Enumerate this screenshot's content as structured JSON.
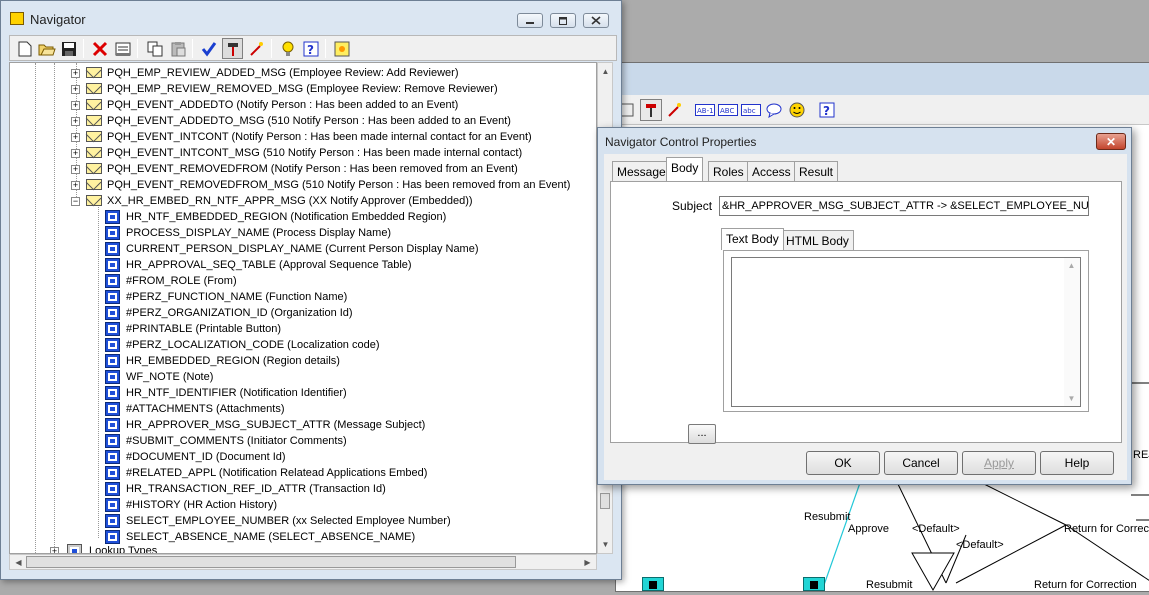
{
  "navigator": {
    "title": "Navigator",
    "window_controls": [
      "minimize",
      "maximize",
      "close"
    ],
    "toolbar_icons": [
      "new-icon",
      "open-icon",
      "save-icon",
      "delete-icon",
      "properties-icon",
      "copy-icon",
      "paste-icon",
      "verify-icon",
      "hammer-icon",
      "wand-icon",
      "lightbulb-icon",
      "help-icon",
      "sun-icon"
    ],
    "tree_rows": [
      {
        "text": "PQH_EMP_REVIEW_ADDED_MSG (Employee Review: Add Reviewer)",
        "kind": "message"
      },
      {
        "text": "PQH_EMP_REVIEW_REMOVED_MSG (Employee Review: Remove Reviewer)",
        "kind": "message"
      },
      {
        "text": "PQH_EVENT_ADDEDTO (Notify Person : Has been added to an Event)",
        "kind": "message"
      },
      {
        "text": "PQH_EVENT_ADDEDTO_MSG (510 Notify Person : Has been added to an Event)",
        "kind": "message"
      },
      {
        "text": "PQH_EVENT_INTCONT (Notify Person : Has been made internal contact for an Event)",
        "kind": "message"
      },
      {
        "text": "PQH_EVENT_INTCONT_MSG (510 Notify Person : Has been made internal contact)",
        "kind": "message"
      },
      {
        "text": "PQH_EVENT_REMOVEDFROM (Notify Person : Has been removed from an Event)",
        "kind": "message"
      },
      {
        "text": "PQH_EVENT_REMOVEDFROM_MSG (510 Notify Person : Has been removed from an Event)",
        "kind": "message"
      },
      {
        "text": "XX_HR_EMBED_RN_NTF_APPR_MSG (XX Notify Approver (Embedded))",
        "kind": "message-open"
      },
      {
        "text": "HR_NTF_EMBEDDED_REGION (Notification Embedded Region)",
        "kind": "attr"
      },
      {
        "text": "PROCESS_DISPLAY_NAME (Process Display Name)",
        "kind": "attr"
      },
      {
        "text": "CURRENT_PERSON_DISPLAY_NAME (Current Person Display Name)",
        "kind": "attr"
      },
      {
        "text": "HR_APPROVAL_SEQ_TABLE (Approval Sequence Table)",
        "kind": "attr"
      },
      {
        "text": "#FROM_ROLE (From)",
        "kind": "attr"
      },
      {
        "text": "#PERZ_FUNCTION_NAME (Function Name)",
        "kind": "attr"
      },
      {
        "text": "#PERZ_ORGANIZATION_ID (Organization Id)",
        "kind": "attr"
      },
      {
        "text": "#PRINTABLE (Printable Button)",
        "kind": "attr"
      },
      {
        "text": "#PERZ_LOCALIZATION_CODE (Localization code)",
        "kind": "attr"
      },
      {
        "text": "HR_EMBEDDED_REGION (Region details)",
        "kind": "attr"
      },
      {
        "text": "WF_NOTE (Note)",
        "kind": "attr"
      },
      {
        "text": "HR_NTF_IDENTIFIER (Notification Identifier)",
        "kind": "attr"
      },
      {
        "text": "#ATTACHMENTS (Attachments)",
        "kind": "attr"
      },
      {
        "text": "HR_APPROVER_MSG_SUBJECT_ATTR (Message Subject)",
        "kind": "attr"
      },
      {
        "text": "#SUBMIT_COMMENTS (Initiator Comments)",
        "kind": "attr"
      },
      {
        "text": "#DOCUMENT_ID (Document Id)",
        "kind": "attr"
      },
      {
        "text": "#RELATED_APPL (Notification Relatead Applications Embed)",
        "kind": "attr"
      },
      {
        "text": "HR_TRANSACTION_REF_ID_ATTR (Transaction Id)",
        "kind": "attr"
      },
      {
        "text": "#HISTORY (HR Action History)",
        "kind": "attr"
      },
      {
        "text": "SELECT_EMPLOYEE_NUMBER (xx Selected Employee Number)",
        "kind": "attr"
      },
      {
        "text": "SELECT_ABSENCE_NAME (SELECT_ABSENCE_NAME)",
        "kind": "attr"
      },
      {
        "text": "Lookup Types",
        "kind": "folder"
      }
    ]
  },
  "dialog": {
    "title": "Navigator Control Properties",
    "close_label": "✕",
    "tabs": [
      "Message",
      "Body",
      "Roles",
      "Access",
      "Result"
    ],
    "active_tab": "Body",
    "subject_label": "Subject",
    "subject_value": "&HR_APPROVER_MSG_SUBJECT_ATTR -> &SELECT_EMPLOYEE_NUMBER",
    "body_tabs": [
      "Text Body",
      "HTML Body"
    ],
    "active_body_tab": "Text Body",
    "text_body_value": "",
    "ellipsis_label": "...",
    "buttons": {
      "ok": "OK",
      "cancel": "Cancel",
      "apply": "Apply",
      "help": "Help"
    }
  },
  "canvas": {
    "labels": {
      "resubmit1": "Resubmit",
      "approve": "Approve",
      "default1": "<Default>",
      "default2": "<Default>",
      "return1": "Return for Correctio",
      "resubmit2": "Resubmit",
      "return2": "Return for Correction",
      "rej": "REJ"
    }
  }
}
